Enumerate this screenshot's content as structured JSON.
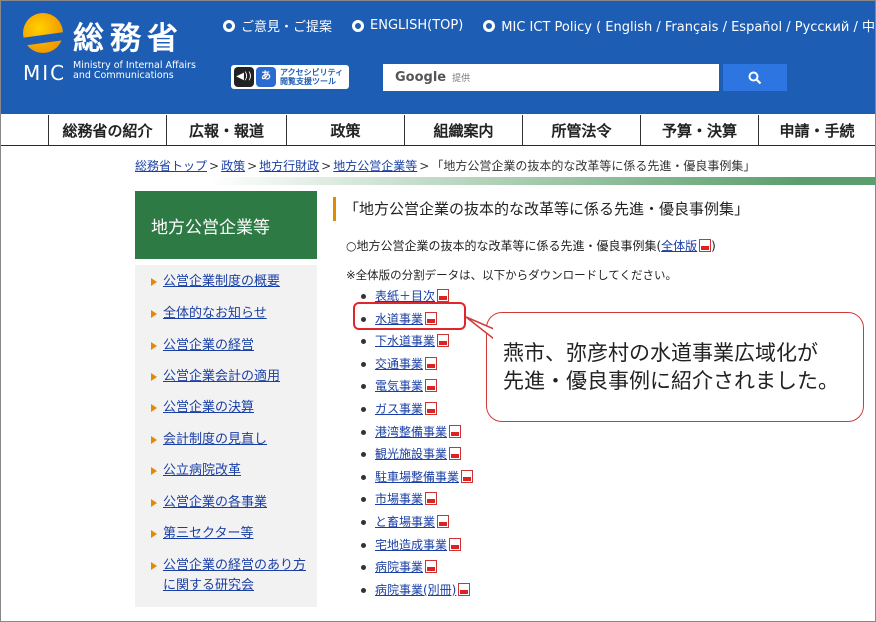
{
  "header": {
    "logo_jp": "総務省",
    "logo_mic": "MIC",
    "logo_en": "Ministry of Internal Affairs\nand Communications",
    "links": [
      {
        "label": "ご意見・ご提案"
      },
      {
        "label": "ENGLISH(TOP)"
      },
      {
        "label": "MIC ICT Policy ( English / Français / Español / Русский / 中"
      }
    ],
    "accessibility": {
      "icon1": "◀))",
      "icon2": "あ",
      "label": "アクセシビリティ\n閲覧支援ツール"
    },
    "search": {
      "brand": "Google",
      "sub": "提供",
      "button_icon": "search-icon"
    }
  },
  "nav": {
    "items": [
      {
        "label": "総務省の紹介"
      },
      {
        "label": "広報・報道"
      },
      {
        "label": "政策"
      },
      {
        "label": "組織案内"
      },
      {
        "label": "所管法令"
      },
      {
        "label": "予算・決算"
      },
      {
        "label": "申請・手続"
      }
    ]
  },
  "breadcrumb": {
    "items": [
      "総務省トップ",
      "政策",
      "地方行財政",
      "地方公営企業等"
    ],
    "current": "「地方公営企業の抜本的な改革等に係る先進・優良事例集」"
  },
  "sidebar": {
    "heading": "地方公営企業等",
    "items": [
      {
        "label": "公営企業制度の概要"
      },
      {
        "label": "全体的なお知らせ"
      },
      {
        "label": "公営企業の経営"
      },
      {
        "label": "公営企業会計の適用"
      },
      {
        "label": "公営企業の決算"
      },
      {
        "label": "会計制度の見直し"
      },
      {
        "label": "公立病院改革"
      },
      {
        "label": "公営企業の各事業"
      },
      {
        "label": "第三セクター等"
      },
      {
        "label": "公営企業の経営のあり方に関する研究会"
      }
    ]
  },
  "content": {
    "title": "「地方公営企業の抜本的な改革等に係る先進・優良事例集」",
    "intro_prefix": "○地方公営企業の抜本的な改革等に係る先進・優良事例集(",
    "intro_link": "全体版",
    "intro_suffix": ")",
    "note": "※全体版の分割データは、以下からダウンロードしてください。",
    "documents": [
      {
        "label": "表紙＋目次"
      },
      {
        "label": "水道事業"
      },
      {
        "label": "下水道事業"
      },
      {
        "label": "交通事業"
      },
      {
        "label": "電気事業"
      },
      {
        "label": "ガス事業"
      },
      {
        "label": "港湾整備事業"
      },
      {
        "label": "観光施設事業"
      },
      {
        "label": "駐車場整備事業"
      },
      {
        "label": "市場事業"
      },
      {
        "label": "と畜場事業"
      },
      {
        "label": "宅地造成事業"
      },
      {
        "label": "病院事業"
      },
      {
        "label": "病院事業(別冊)"
      }
    ]
  },
  "callout": {
    "line1": "燕市、弥彦村の水道事業広域化が",
    "line2": "先進・優良事例に紹介されました。",
    "border_color": "#d23a3a"
  },
  "colors": {
    "header_blue": "#1d5db3",
    "sidebar_green": "#2e7a44",
    "accent_orange": "#e08b00",
    "link_blue": "#1a3fa5"
  }
}
